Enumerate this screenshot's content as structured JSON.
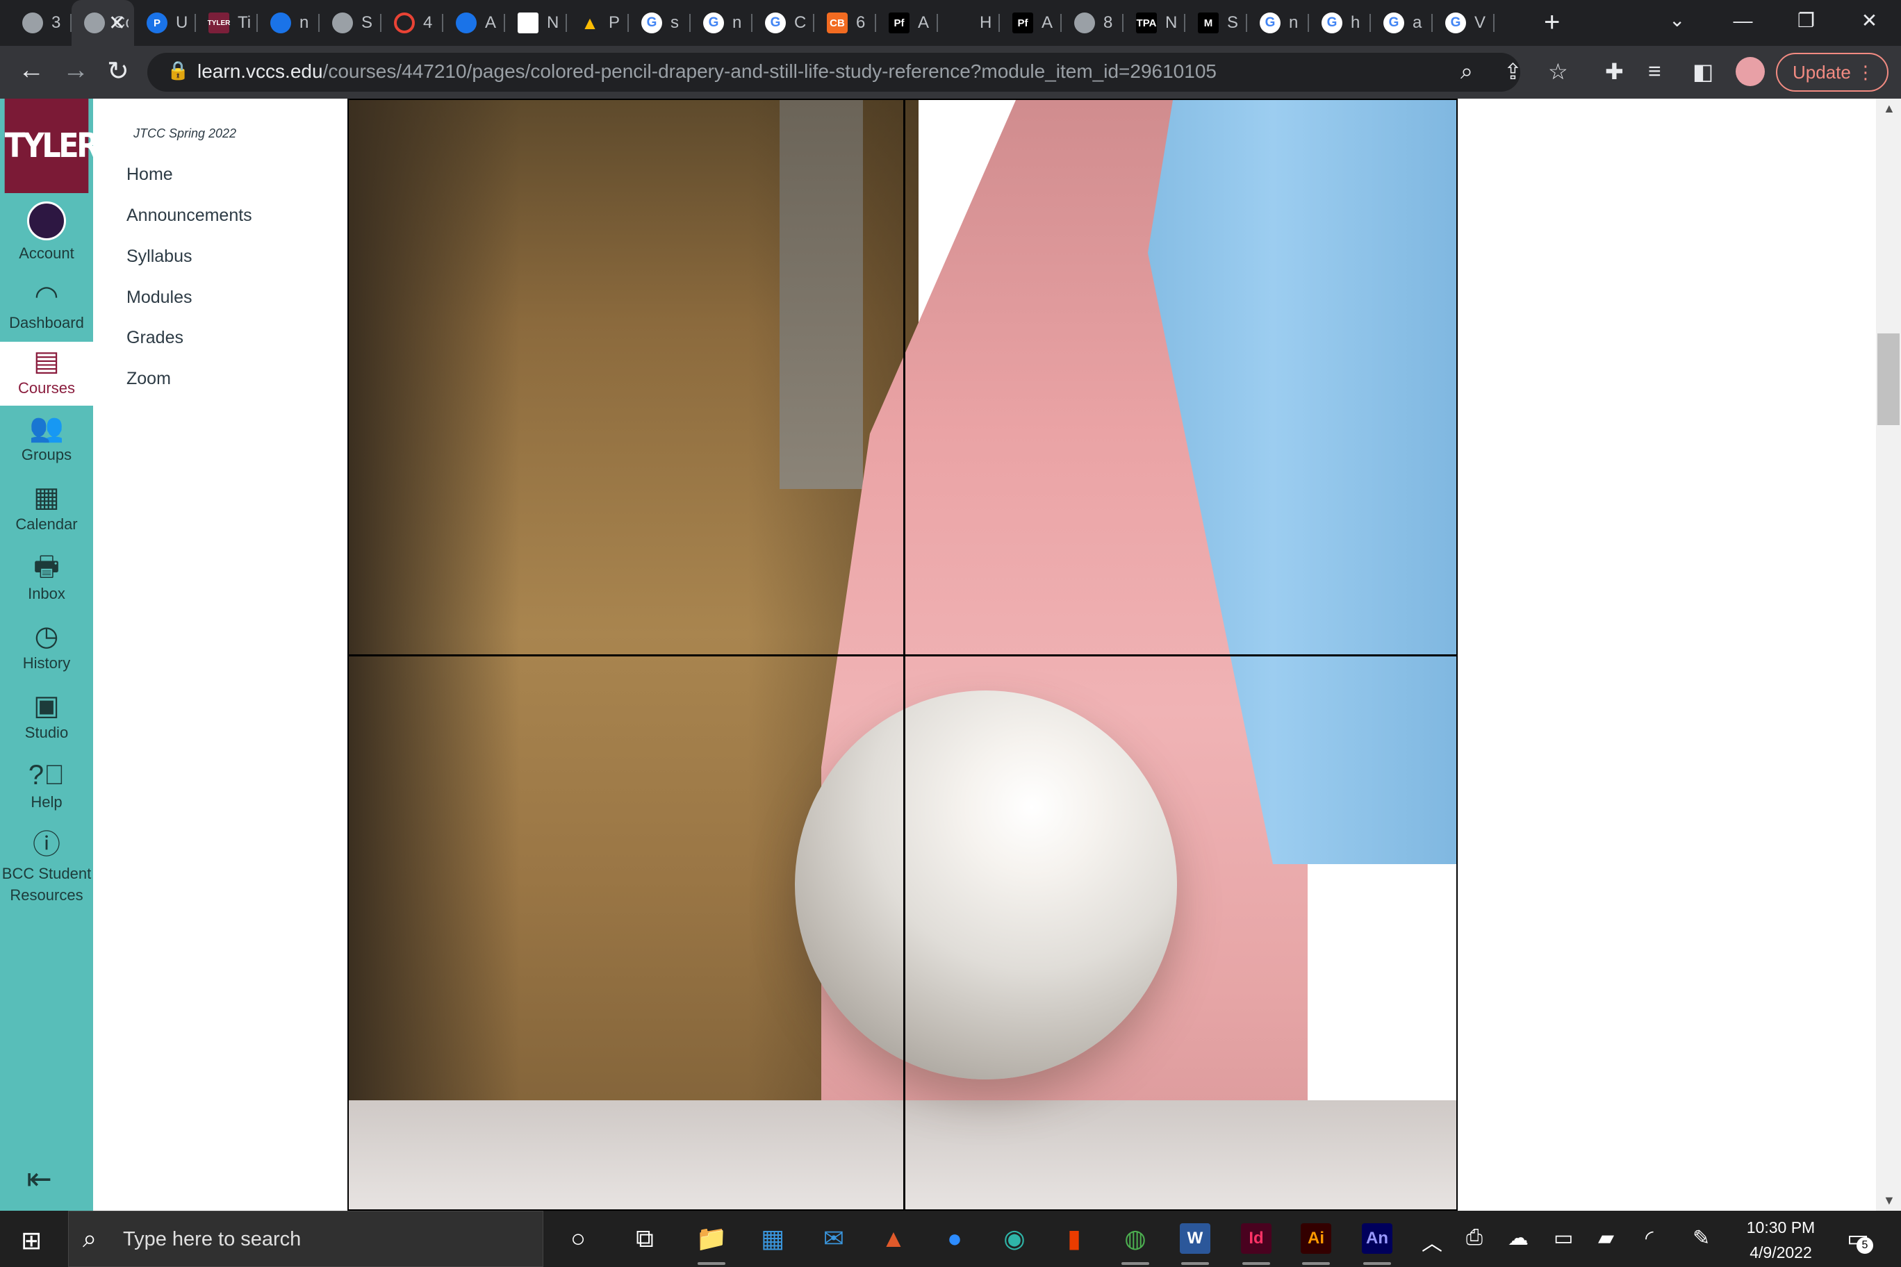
{
  "browser": {
    "tabs": [
      {
        "icon": "globe-icon",
        "glyph": "",
        "label": "3"
      },
      {
        "icon": "canvas-icon",
        "glyph": "",
        "label": "Co",
        "active": true
      },
      {
        "icon": "pearson-icon",
        "glyph": "P",
        "label": "U"
      },
      {
        "icon": "tyler-icon",
        "glyph": "TYLER",
        "label": "Ti"
      },
      {
        "icon": "drop-icon",
        "glyph": "",
        "label": "n"
      },
      {
        "icon": "globe-icon",
        "glyph": "",
        "label": "S"
      },
      {
        "icon": "opera-icon",
        "glyph": "",
        "label": "4"
      },
      {
        "icon": "layers-icon",
        "glyph": "",
        "label": "A"
      },
      {
        "icon": "wolf-icon",
        "glyph": "",
        "label": "N"
      },
      {
        "icon": "drive-icon",
        "glyph": "▲",
        "label": "P"
      },
      {
        "icon": "google-icon",
        "glyph": "G",
        "label": "s"
      },
      {
        "icon": "google-icon",
        "glyph": "G",
        "label": "n"
      },
      {
        "icon": "google-icon",
        "glyph": "G",
        "label": "C"
      },
      {
        "icon": "cb-icon",
        "glyph": "CB",
        "label": "6"
      },
      {
        "icon": "pf-icon",
        "glyph": "Pf",
        "label": "A"
      },
      {
        "icon": "blank-icon",
        "glyph": "",
        "label": "H"
      },
      {
        "icon": "pf-icon",
        "glyph": "Pf",
        "label": "A"
      },
      {
        "icon": "message-icon",
        "glyph": "",
        "label": "8"
      },
      {
        "icon": "tpa-icon",
        "glyph": "TPA",
        "label": "N"
      },
      {
        "icon": "m-icon",
        "glyph": "M",
        "label": "S"
      },
      {
        "icon": "google-icon",
        "glyph": "G",
        "label": "n"
      },
      {
        "icon": "google-icon",
        "glyph": "G",
        "label": "h"
      },
      {
        "icon": "google-icon",
        "glyph": "G",
        "label": "a"
      },
      {
        "icon": "google-icon",
        "glyph": "G",
        "label": "V"
      }
    ],
    "new_tab_glyph": "+",
    "url_host": "learn.vccs.edu",
    "url_path": "/courses/447210/pages/colored-pencil-drapery-and-still-life-study-reference?module_item_id=29610105",
    "update_label": "Update",
    "update_color": "#f28b82"
  },
  "global_nav": {
    "logo_text": "TYLER",
    "brand_color": "#7b1a36",
    "nav_bg": "#58beb9",
    "items": [
      {
        "label": "Account",
        "icon": "avatar"
      },
      {
        "label": "Dashboard",
        "icon": "dashboard-icon"
      },
      {
        "label": "Courses",
        "icon": "courses-icon",
        "active": true
      },
      {
        "label": "Groups",
        "icon": "groups-icon"
      },
      {
        "label": "Calendar",
        "icon": "calendar-icon"
      },
      {
        "label": "Inbox",
        "icon": "inbox-icon"
      },
      {
        "label": "History",
        "icon": "history-icon"
      },
      {
        "label": "Studio",
        "icon": "studio-icon"
      },
      {
        "label": "Help",
        "icon": "help-icon"
      },
      {
        "label": "BCC Student Resources",
        "icon": "info-icon"
      }
    ]
  },
  "course_nav": {
    "term": "JTCC Spring 2022",
    "items": [
      "Home",
      "Announcements",
      "Syllabus",
      "Modules",
      "Grades",
      "Zoom"
    ]
  },
  "taskbar": {
    "search_placeholder": "Type here to search",
    "apps": [
      "cortana-icon",
      "task-view-icon",
      "file-explorer-icon",
      "microsoft-store-icon",
      "mail-icon",
      "app-icon",
      "zoom-icon",
      "edge-icon",
      "office-icon",
      "chrome-icon",
      "word-icon",
      "indesign-icon",
      "illustrator-icon",
      "animate-icon"
    ],
    "app_labels": {
      "word": "W",
      "indesign": "Id",
      "illustrator": "Ai",
      "animate": "An"
    },
    "time": "10:30 PM",
    "date": "4/9/2022",
    "notification_count": "5"
  }
}
